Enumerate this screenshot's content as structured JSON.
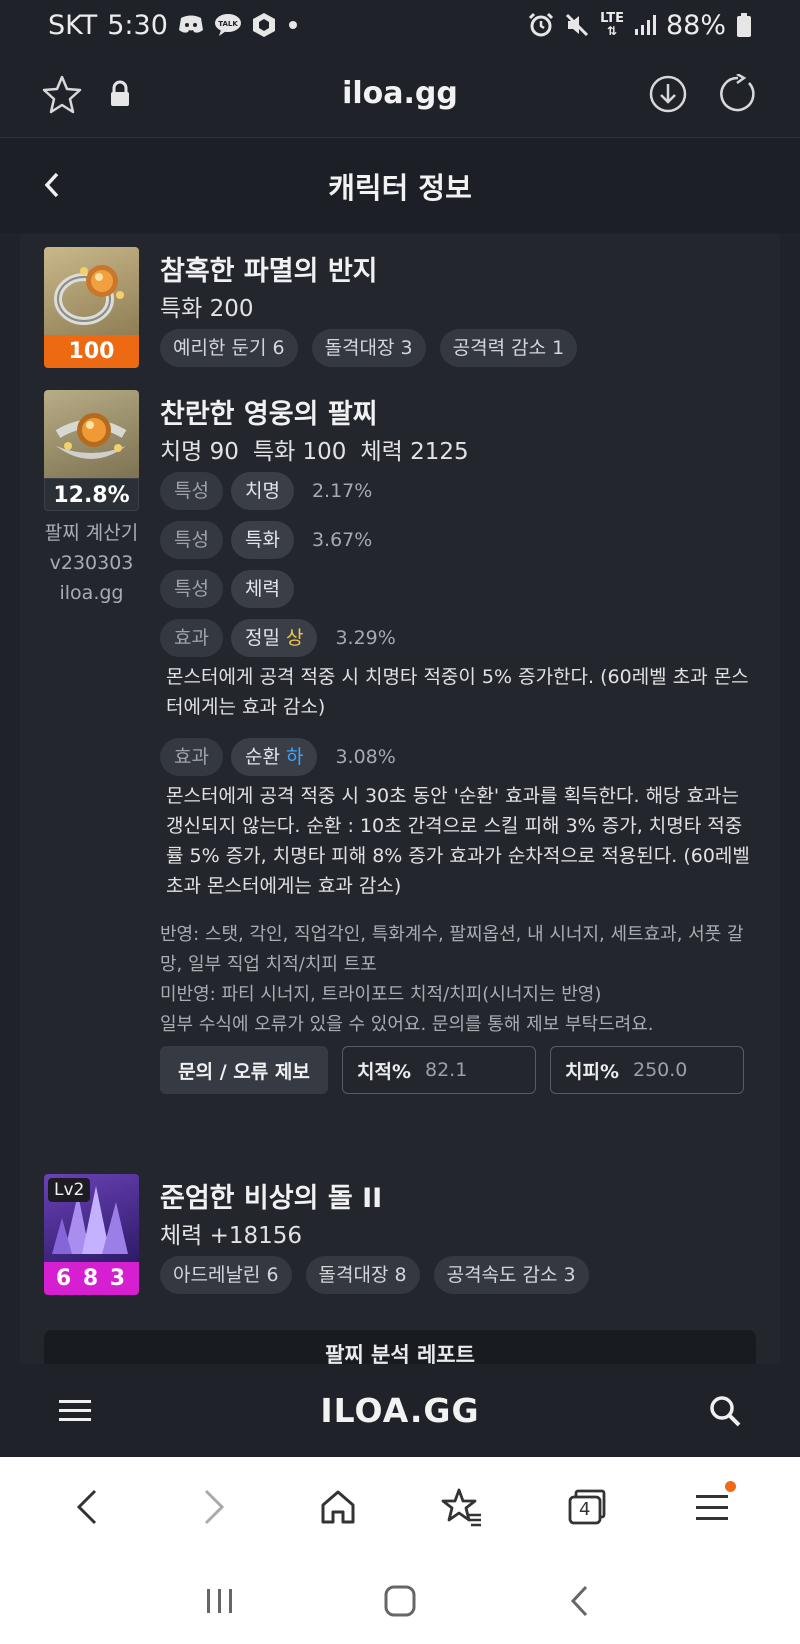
{
  "status_bar": {
    "carrier": "SKT",
    "time": "5:30",
    "network": "LTE",
    "battery": "88%"
  },
  "browser": {
    "url": "iloa.gg"
  },
  "page": {
    "title": "캐릭터 정보"
  },
  "items": [
    {
      "name": "참혹한 파멸의 반지",
      "stats": "특화 200",
      "badge": "100",
      "badge_color": "#ee6a12",
      "engravings": [
        "예리한 둔기 6",
        "돌격대장 3",
        "공격력 감소 1"
      ]
    },
    {
      "name": "찬란한 영웅의 팔찌",
      "stats": [
        "치명 90",
        "특화 100",
        "체력 2125"
      ],
      "badge": "12.8%",
      "badge_color": "#2b2f36",
      "caption": [
        "팔찌 계산기",
        "v230303",
        "iloa.gg"
      ],
      "effects": [
        {
          "kind": "특성",
          "name": "치명",
          "grade": "",
          "value": "2.17%"
        },
        {
          "kind": "특성",
          "name": "특화",
          "grade": "",
          "value": "3.67%"
        },
        {
          "kind": "특성",
          "name": "체력",
          "grade": "",
          "value": ""
        },
        {
          "kind": "효과",
          "name": "정밀",
          "grade": "상",
          "value": "3.29%",
          "desc": "몬스터에게 공격 적중 시 치명타 적중이 5% 증가한다. (60레벨 초과 몬스터에게는 효과 감소)"
        },
        {
          "kind": "효과",
          "name": "순환",
          "grade": "하",
          "value": "3.08%",
          "desc": "몬스터에게 공격 적중 시 30초 동안 '순환' 효과를 획득한다. 해당 효과는 갱신되지 않는다. 순환 : 10초 간격으로 스킬 피해 3% 증가, 치명타 적중률 5% 증가, 치명타 피해 8% 증가 효과가 순차적으로 적용된다. (60레벨 초과 몬스터에게는 효과 감소)"
        }
      ],
      "notes": [
        "반영: 스탯, 각인, 직업각인, 특화계수, 팔찌옵션, 내 시너지, 세트효과, 서풋 갈망, 일부 직업 치적/치피 트포",
        "미반영: 파티 시너지, 트라이포드 치적/치피(시너지는 반영)",
        "일부 수식에 오류가 있을 수 있어요. 문의를 통해 제보 부탁드려요."
      ],
      "report_button": "문의 / 오류 제보",
      "crit_rate_label": "치적%",
      "crit_rate_value": "82.1",
      "crit_dmg_label": "치피%",
      "crit_dmg_value": "250.0"
    },
    {
      "name": "준엄한 비상의 돌 II",
      "stats": "체력 +18156",
      "level": "Lv2",
      "badge": "6 8 3",
      "badge_color": "#d51fd1",
      "engravings": [
        "아드레날린 6",
        "돌격대장 8",
        "공격속도 감소 3"
      ]
    }
  ],
  "report_bar": "팔찌 분석 레포트",
  "site_footer": {
    "logo": "ILOA.GG"
  },
  "browser_nav": {
    "tab_count": "4"
  },
  "icons": {
    "status_left": [
      "discord-icon",
      "kakaotalk-icon",
      "cube-icon",
      "dot-icon"
    ],
    "status_right": [
      "alarm-icon",
      "mute-icon",
      "lte-icon",
      "signal-icon",
      "battery-icon"
    ]
  }
}
